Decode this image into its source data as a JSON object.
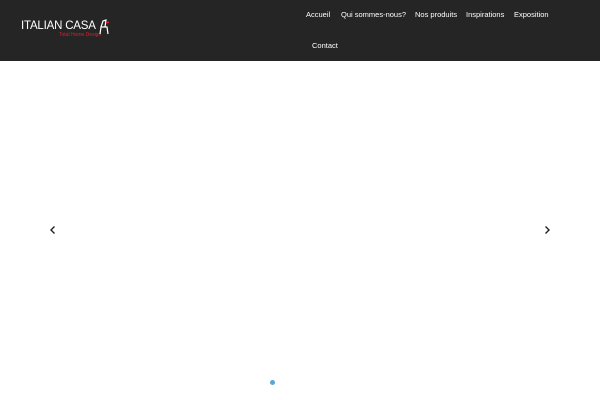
{
  "brand": {
    "name": "ITALIAN CASA",
    "tagline": "Total Home Design",
    "accent_color": "#d8222b"
  },
  "nav": {
    "items": [
      {
        "label": "Accueil"
      },
      {
        "label": "Qui sommes-nous?"
      },
      {
        "label": "Nos produits"
      },
      {
        "label": "Inspirations"
      },
      {
        "label": "Exposition"
      },
      {
        "label": "Contact"
      }
    ]
  },
  "slider": {
    "prev_icon": "chevron-left-icon",
    "next_icon": "chevron-right-icon",
    "dot_color": "#5aa7d6"
  }
}
